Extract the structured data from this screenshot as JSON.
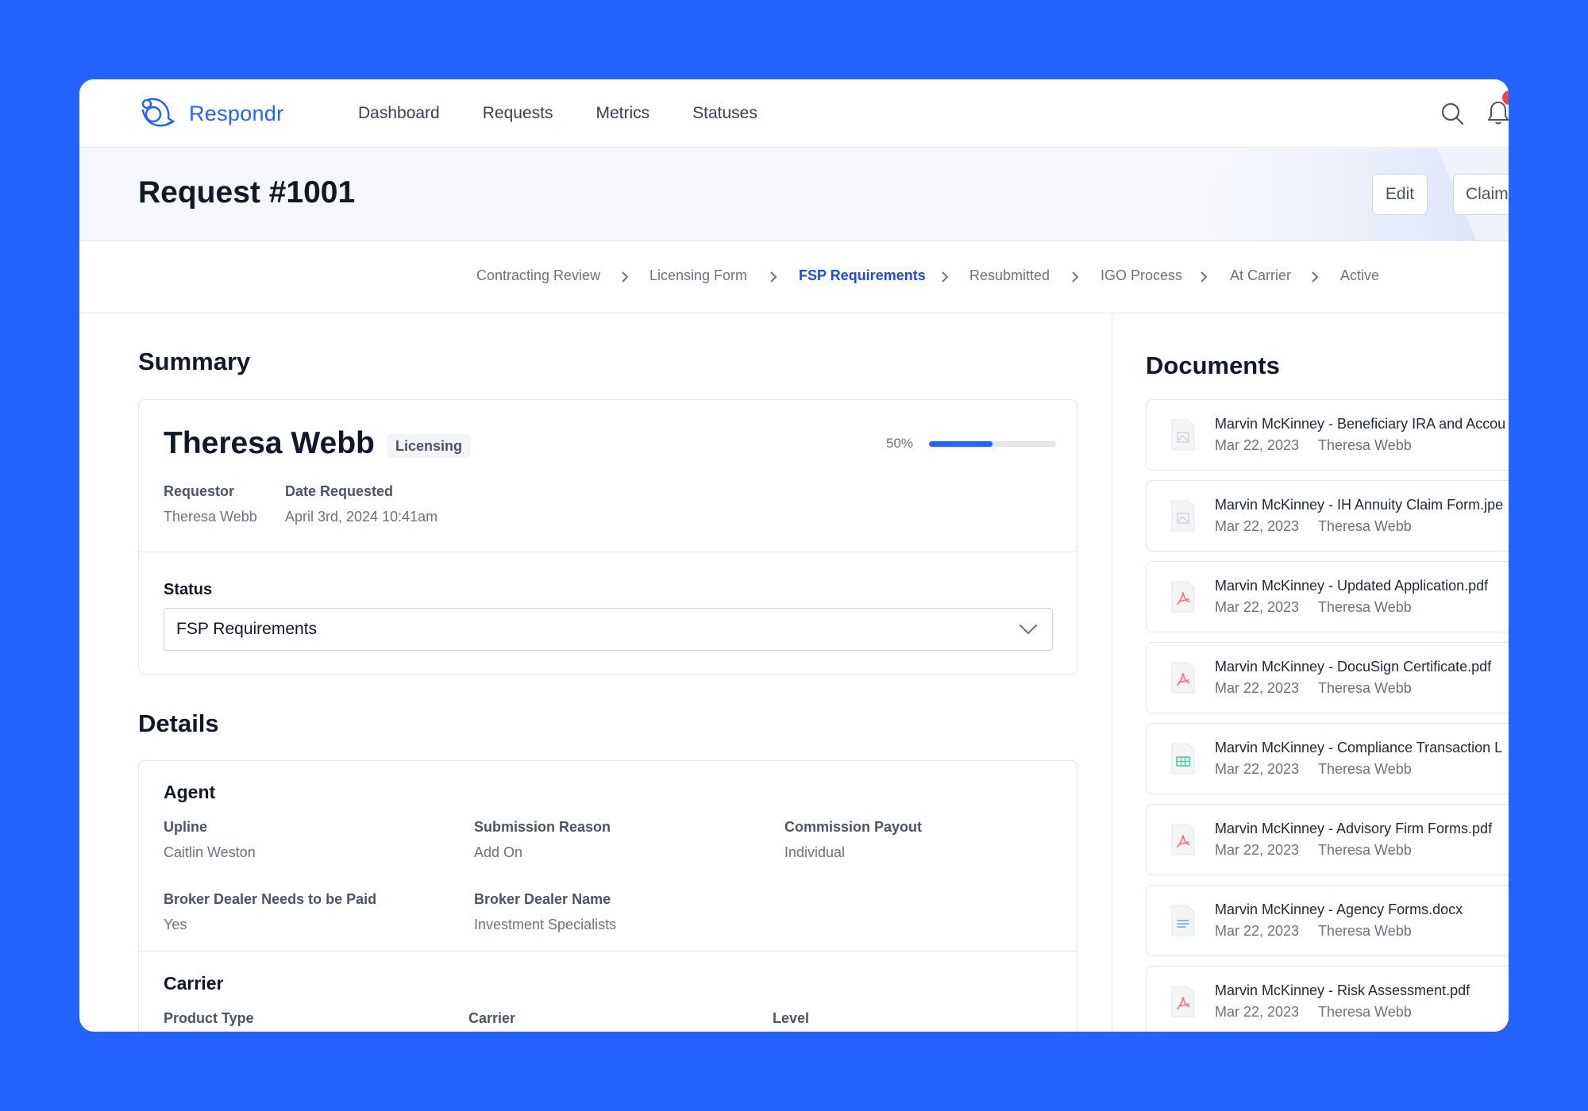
{
  "app": {
    "brand": "Respondr"
  },
  "nav": {
    "items": [
      "Dashboard",
      "Requests",
      "Metrics",
      "Statuses"
    ]
  },
  "header": {
    "title": "Request #1001",
    "edit_label": "Edit",
    "claim_label": "Claim"
  },
  "stepper": {
    "steps": [
      "Contracting Review",
      "Licensing Form",
      "FSP Requirements",
      "Resubmitted",
      "IGO Process",
      "At Carrier",
      "Active"
    ],
    "active": "FSP Requirements"
  },
  "summary": {
    "title": "Summary",
    "name": "Theresa Webb",
    "badge": "Licensing",
    "progress_label": "50%",
    "progress": 0.5,
    "requestor_label": "Requestor",
    "requestor": "Theresa Webb",
    "date_label": "Date Requested",
    "date": "April 3rd, 2024 10:41am",
    "status_label": "Status",
    "status_value": "FSP Requirements"
  },
  "details": {
    "title": "Details",
    "agent": {
      "title": "Agent",
      "fields": [
        {
          "label": "Upline",
          "value": "Caitlin Weston"
        },
        {
          "label": "Submission Reason",
          "value": "Add On"
        },
        {
          "label": "Commission Payout",
          "value": "Individual"
        },
        {
          "label": "Broker Dealer Needs to be Paid",
          "value": "Yes"
        },
        {
          "label": "Broker Dealer Name",
          "value": "Investment Specialists"
        }
      ]
    },
    "carrier": {
      "title": "Carrier",
      "fields": [
        {
          "label": "Product Type"
        },
        {
          "label": "Carrier"
        },
        {
          "label": "Level"
        }
      ]
    }
  },
  "documents": {
    "title": "Documents",
    "items": [
      {
        "name": "Marvin McKinney - Beneficiary IRA and Accou",
        "date": "Mar 22, 2023",
        "owner": "Theresa Webb",
        "icon": "image-file-icon"
      },
      {
        "name": "Marvin McKinney - IH Annuity Claim Form.jpe",
        "date": "Mar 22, 2023",
        "owner": "Theresa Webb",
        "icon": "image-file-icon"
      },
      {
        "name": "Marvin McKinney - Updated Application.pdf",
        "date": "Mar 22, 2023",
        "owner": "Theresa Webb",
        "icon": "pdf-file-icon"
      },
      {
        "name": "Marvin McKinney - DocuSign Certificate.pdf",
        "date": "Mar 22, 2023",
        "owner": "Theresa Webb",
        "icon": "pdf-file-icon"
      },
      {
        "name": "Marvin McKinney - Compliance Transaction L",
        "date": "Mar 22, 2023",
        "owner": "Theresa Webb",
        "icon": "spreadsheet-file-icon"
      },
      {
        "name": "Marvin McKinney - Advisory Firm Forms.pdf",
        "date": "Mar 22, 2023",
        "owner": "Theresa Webb",
        "icon": "pdf-file-icon"
      },
      {
        "name": "Marvin McKinney - Agency Forms.docx",
        "date": "Mar 22, 2023",
        "owner": "Theresa Webb",
        "icon": "text-file-icon"
      },
      {
        "name": "Marvin McKinney - Risk Assessment.pdf",
        "date": "Mar 22, 2023",
        "owner": "Theresa Webb",
        "icon": "pdf-file-icon"
      }
    ]
  },
  "colors": {
    "accent": "#2463FF",
    "active_step": "#1D4ED8",
    "notification": "#EF4444",
    "pdf": "#F87171",
    "sheet": "#34D399",
    "doc": "#60A5FA"
  }
}
